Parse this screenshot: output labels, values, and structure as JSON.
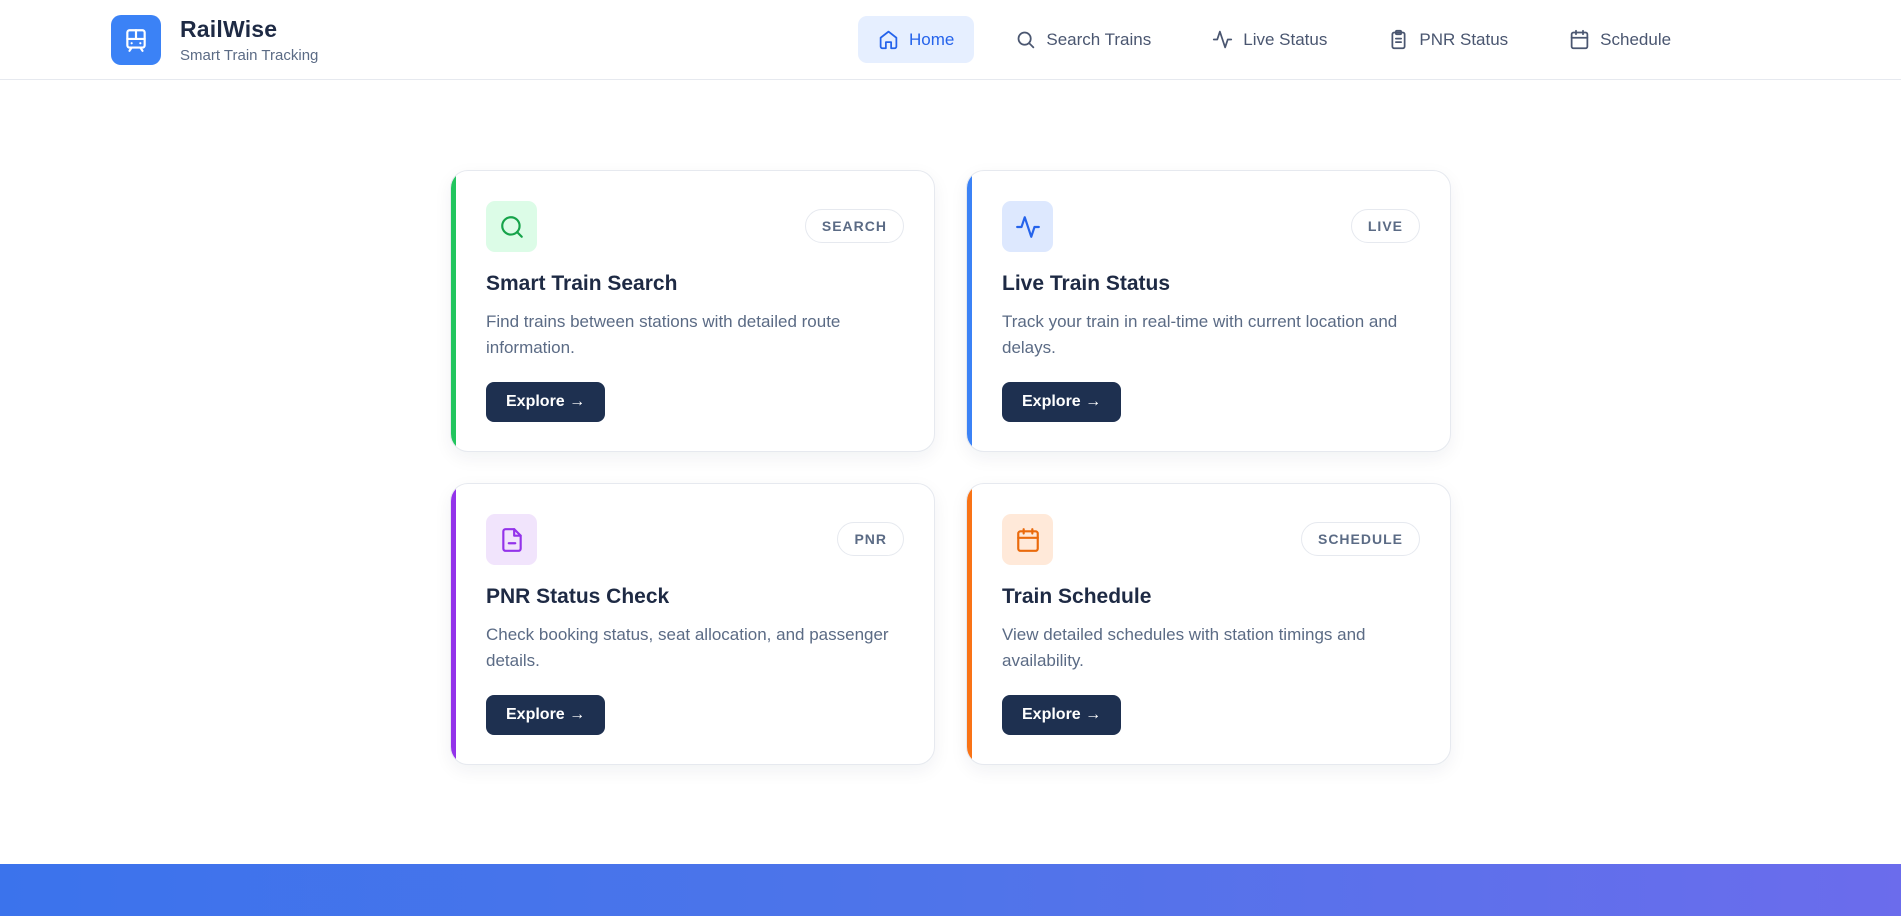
{
  "header": {
    "brand_name": "RailWise",
    "brand_tagline": "Smart Train Tracking",
    "logo_icon": "train-icon",
    "nav": [
      {
        "label": "Home",
        "icon": "home-icon",
        "active": true
      },
      {
        "label": "Search Trains",
        "icon": "search-icon",
        "active": false
      },
      {
        "label": "Live Status",
        "icon": "activity-icon",
        "active": false
      },
      {
        "label": "PNR Status",
        "icon": "clipboard-icon",
        "active": false
      },
      {
        "label": "Schedule",
        "icon": "calendar-icon",
        "active": false
      }
    ]
  },
  "cards": [
    {
      "title": "Smart Train Search",
      "badge": "SEARCH",
      "description": "Find trains between stations with detailed route information.",
      "button": "Explore →",
      "icon": "search-icon",
      "accent_color": "#22c55e",
      "icon_bg": "#dcfce7",
      "icon_color": "#16a34a"
    },
    {
      "title": "Live Train Status",
      "badge": "LIVE",
      "description": "Track your train in real-time with current location and delays.",
      "button": "Explore →",
      "icon": "activity-icon",
      "accent_color": "#3b82f6",
      "icon_bg": "#dde8fe",
      "icon_color": "#2563eb"
    },
    {
      "title": "PNR Status Check",
      "badge": "PNR",
      "description": "Check booking status, seat allocation, and passenger details.",
      "button": "Explore →",
      "icon": "document-icon",
      "accent_color": "#9333ea",
      "icon_bg": "#f1e4fc",
      "icon_color": "#9333ea"
    },
    {
      "title": "Train Schedule",
      "badge": "SCHEDULE",
      "description": "View detailed schedules with station timings and availability.",
      "button": "Explore →",
      "icon": "calendar-icon",
      "accent_color": "#f97316",
      "icon_bg": "#ffe9d9",
      "icon_color": "#ea6a0c"
    }
  ],
  "colors": {
    "brand": "#3b82f6",
    "button_dark": "#1e3050",
    "nav_active_bg": "#e6efff",
    "nav_active_text": "#2563eb"
  }
}
